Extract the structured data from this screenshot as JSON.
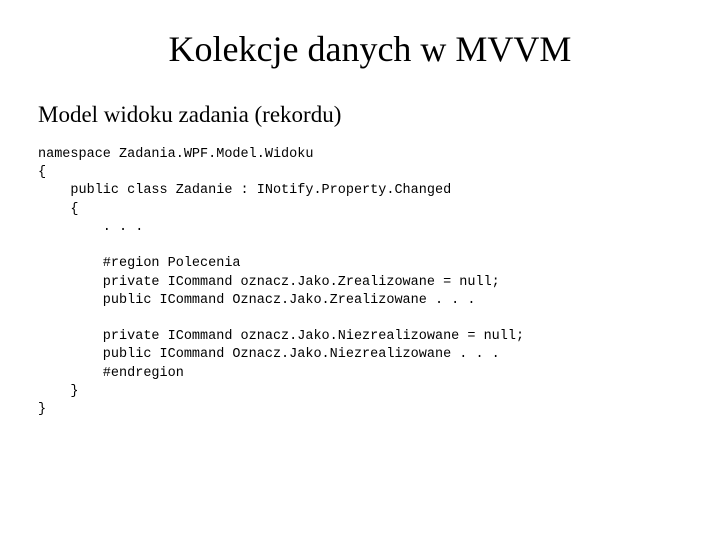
{
  "title": "Kolekcje danych w MVVM",
  "subtitle": "Model widoku zadania (rekordu)",
  "code": "namespace Zadania.WPF.Model.Widoku\n{\n    public class Zadanie : INotify.Property.Changed\n    {\n        . . .\n\n        #region Polecenia\n        private ICommand oznacz.Jako.Zrealizowane = null;\n        public ICommand Oznacz.Jako.Zrealizowane . . .\n\n        private ICommand oznacz.Jako.Niezrealizowane = null;\n        public ICommand Oznacz.Jako.Niezrealizowane . . .\n        #endregion\n    }\n}"
}
